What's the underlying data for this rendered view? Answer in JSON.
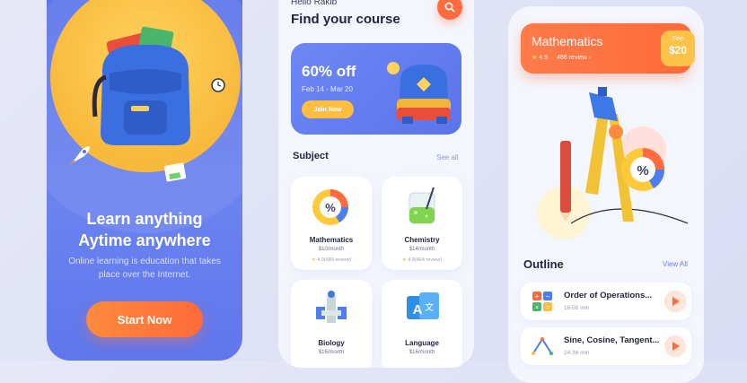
{
  "onboarding": {
    "headline_line1": "Learn anything",
    "headline_line2": "Aytime anywhere",
    "description": "Online learning is education that takes place over the Internet.",
    "start_label": "Start Now"
  },
  "home": {
    "greeting": "Hello Rakib",
    "title": "Find your course",
    "search_icon": "search-icon",
    "promo": {
      "discount": "60% off",
      "dates": "Feb 14 - Mar 20",
      "join_label": "Join Now"
    },
    "subject_heading": "Subject",
    "see_all": "See all",
    "courses": [
      {
        "name": "Mathematics",
        "price": "$10/month",
        "rating": "4.9(689 review)"
      },
      {
        "name": "Chemistry",
        "price": "$14/month",
        "rating": "4.8(464 review)"
      },
      {
        "name": "Biology",
        "price": "$16/month"
      },
      {
        "name": "Language",
        "price": "$16/month"
      }
    ]
  },
  "detail": {
    "course_name": "Mathematics",
    "rating": "4.9",
    "reviews": "486 review",
    "fee_label": "Fee",
    "fee_value": "$20",
    "outline_heading": "Outline",
    "view_all": "View All",
    "lessons": [
      {
        "title": "Order of Operations...",
        "duration": "16:56 min"
      },
      {
        "title": "Sine, Cosine, Tangent...",
        "duration": "24:36 min"
      }
    ]
  },
  "colors": {
    "primary_blue": "#5b74ea",
    "accent_orange": "#ff6b3f",
    "accent_yellow": "#ffbe3f"
  }
}
